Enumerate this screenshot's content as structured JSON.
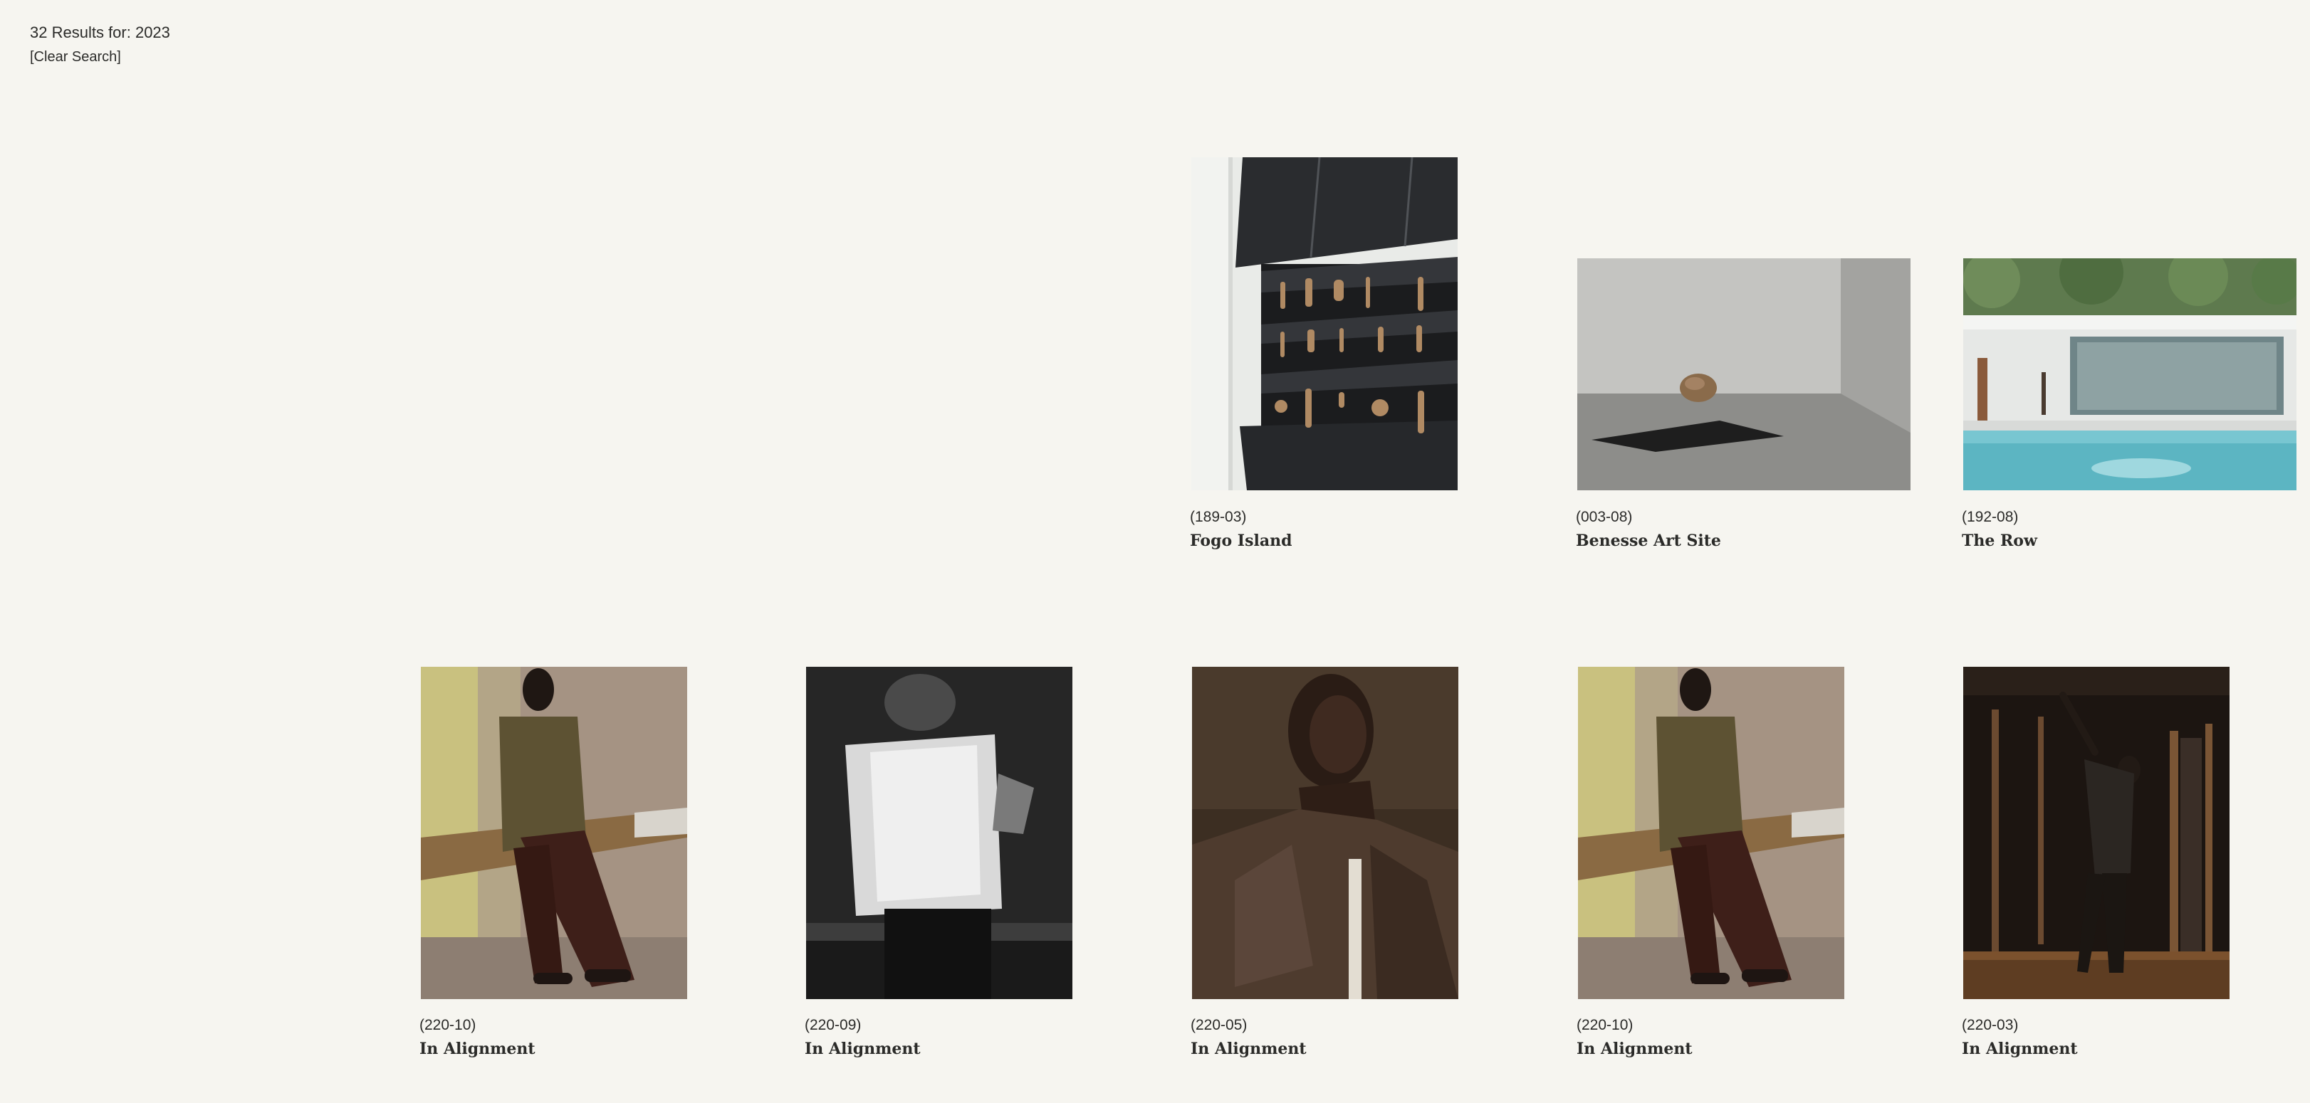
{
  "search": {
    "summary": "32 Results for: 2023",
    "clear_label": "[Clear Search]"
  },
  "results": [
    {
      "code": "(189-03)",
      "title": "Fogo Island",
      "image": "fogo-island-shelving"
    },
    {
      "code": "(003-08)",
      "title": "Benesse Art Site",
      "image": "benesse-courtyard-boulder"
    },
    {
      "code": "(192-08)",
      "title": "The Row",
      "image": "the-row-pool-house"
    },
    {
      "code": "(220-10)",
      "title": "In Alignment",
      "image": "man-leaning-on-bench"
    },
    {
      "code": "(220-09)",
      "title": "In Alignment",
      "image": "blurred-figure"
    },
    {
      "code": "(220-05)",
      "title": "In Alignment",
      "image": "man-portrait"
    },
    {
      "code": "(220-10)",
      "title": "In Alignment",
      "image": "man-leaning-on-bench"
    },
    {
      "code": "(220-03)",
      "title": "In Alignment",
      "image": "dancer-in-room"
    }
  ]
}
